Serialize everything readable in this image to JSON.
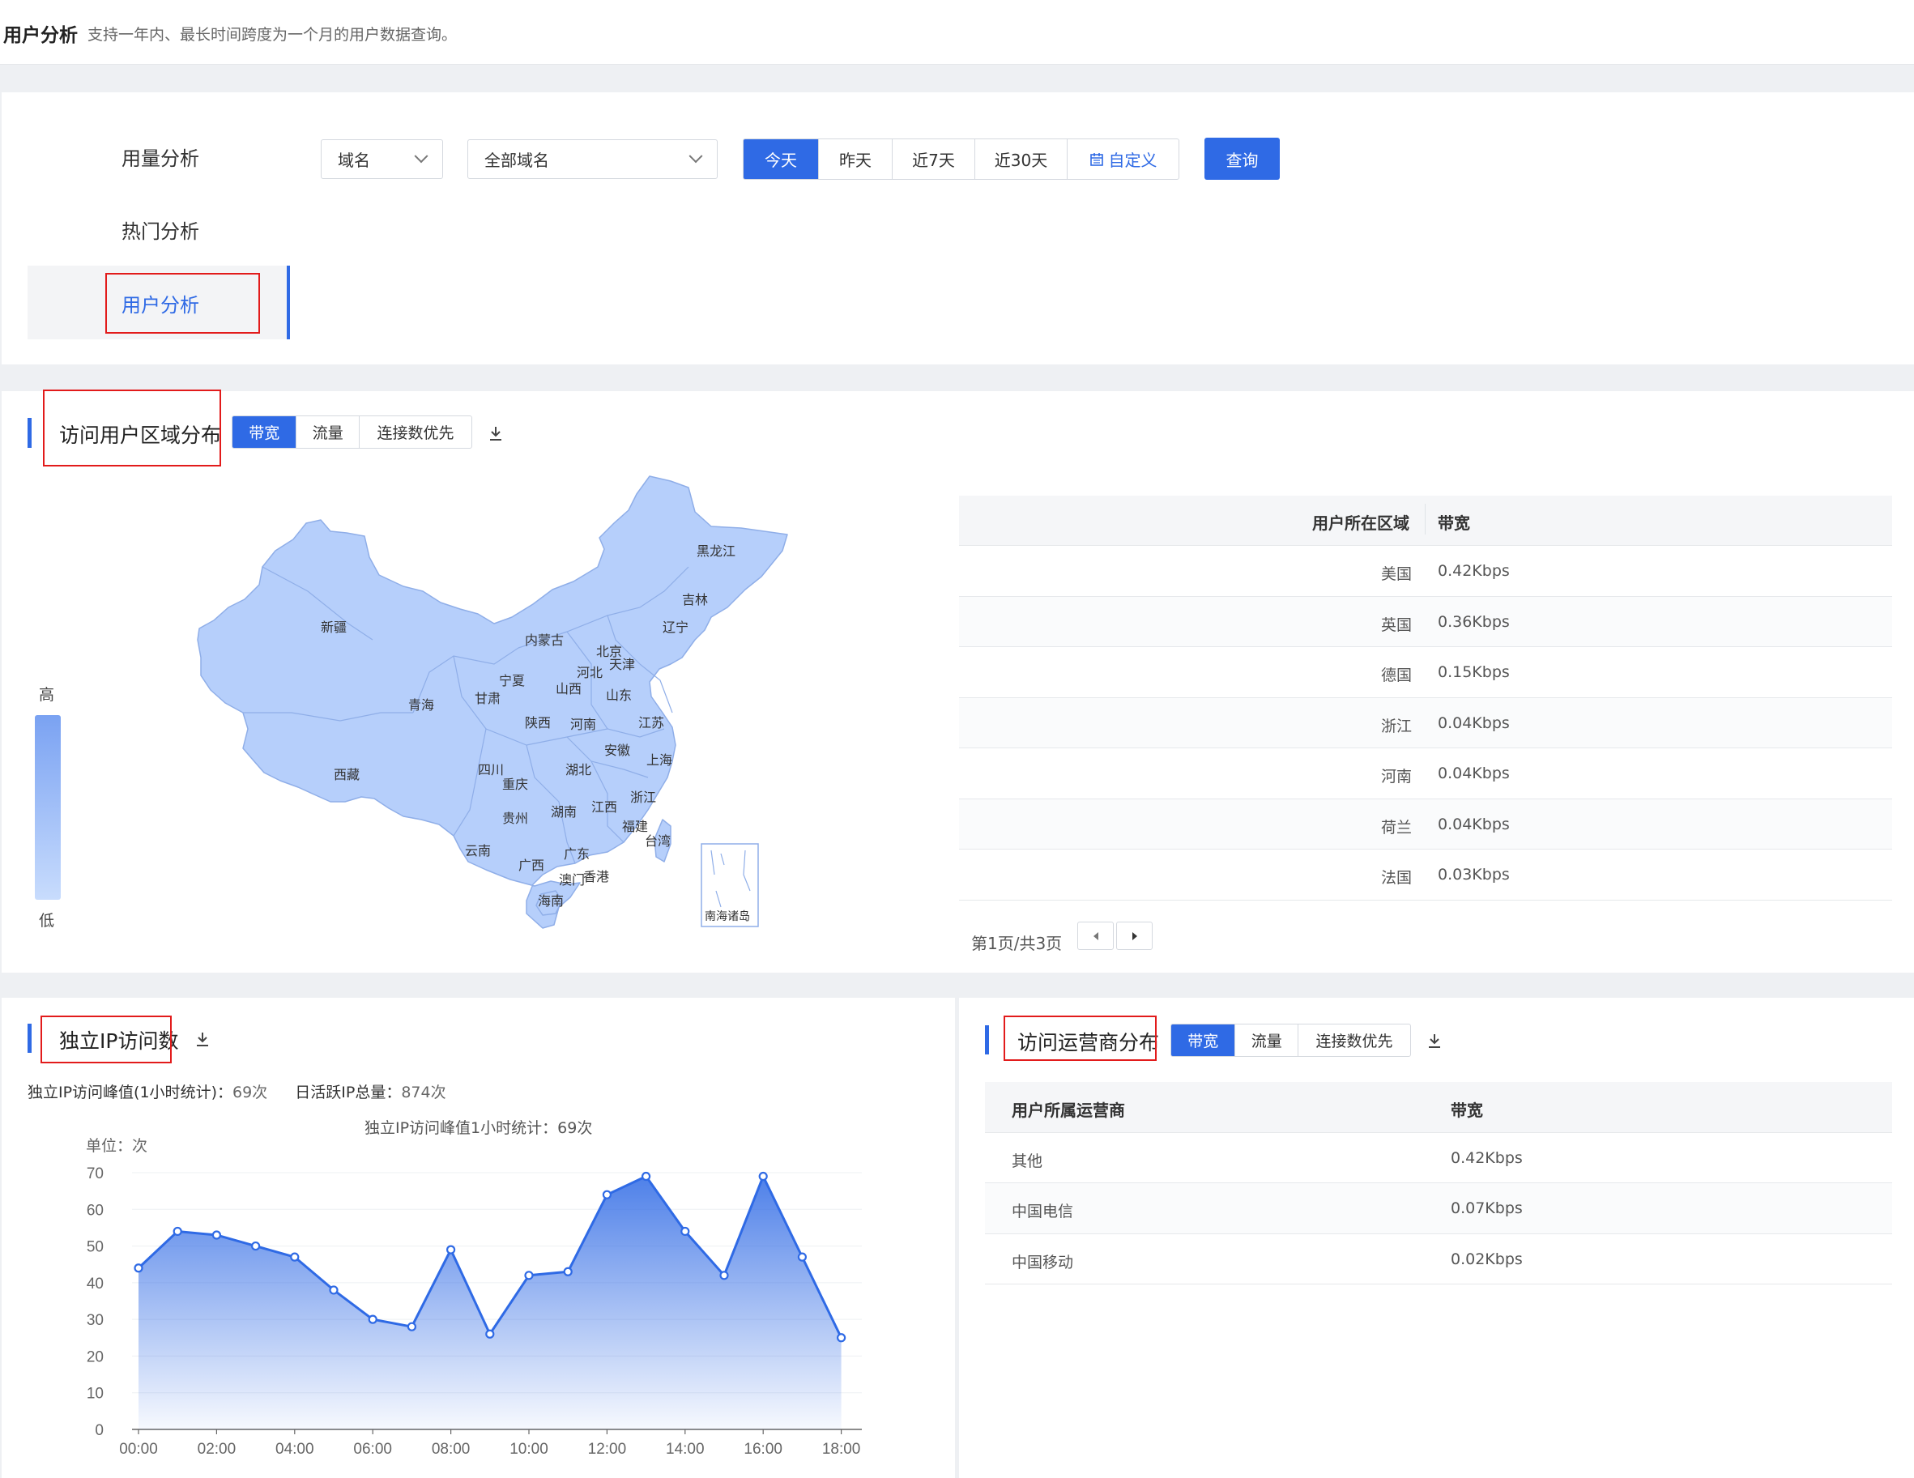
{
  "page": {
    "title": "用户分析",
    "subtitle": "支持一年内、最长时间跨度为一个月的用户数据查询。"
  },
  "nav": {
    "items": [
      {
        "label": "用量分析",
        "active": false
      },
      {
        "label": "热门分析",
        "active": false
      },
      {
        "label": "用户分析",
        "active": true
      }
    ]
  },
  "filters": {
    "type_select": "域名",
    "domain_select": "全部域名",
    "time_ranges": [
      "今天",
      "昨天",
      "近7天",
      "近30天"
    ],
    "time_active": "今天",
    "custom_label": "自定义",
    "query_button": "查询"
  },
  "region": {
    "title": "访问用户区域分布",
    "tabs": [
      "带宽",
      "流量",
      "连接数优先"
    ],
    "active_tab": "带宽",
    "legend_high": "高",
    "legend_low": "低",
    "map_colors": {
      "fill": "#b6cffb",
      "stroke": "#8faee8",
      "legend_top": "#7aa2f2",
      "legend_bottom": "#c8dcfd"
    },
    "provinces": [
      "黑龙江",
      "吉林",
      "辽宁",
      "内蒙古",
      "北京",
      "天津",
      "河北",
      "宁夏",
      "甘肃",
      "山西",
      "山东",
      "新疆",
      "青海",
      "陕西",
      "河南",
      "江苏",
      "安徽",
      "上海",
      "西藏",
      "四川",
      "重庆",
      "湖北",
      "浙江",
      "湖南",
      "江西",
      "贵州",
      "福建",
      "台湾",
      "云南",
      "广西",
      "广东",
      "澳门",
      "香港",
      "海南",
      "南海诸岛"
    ],
    "table": {
      "headers": [
        "用户所在区域",
        "带宽"
      ],
      "rows": [
        {
          "region": "美国",
          "value": "0.42Kbps"
        },
        {
          "region": "英国",
          "value": "0.36Kbps"
        },
        {
          "region": "德国",
          "value": "0.15Kbps"
        },
        {
          "region": "浙江",
          "value": "0.04Kbps"
        },
        {
          "region": "河南",
          "value": "0.04Kbps"
        },
        {
          "region": "荷兰",
          "value": "0.04Kbps"
        },
        {
          "region": "法国",
          "value": "0.03Kbps"
        }
      ],
      "pager": "第1页/共3页"
    }
  },
  "unique_ip": {
    "title": "独立IP访问数",
    "peak_label": "独立IP访问峰值(1小时统计)：",
    "peak_value": "69次",
    "total_label": "日活跃IP总量：",
    "total_value": "874次",
    "chart_caption": "独立IP访问峰值1小时统计：69次",
    "unit_label": "单位：次"
  },
  "isp": {
    "title": "访问运营商分布",
    "tabs": [
      "带宽",
      "流量",
      "连接数优先"
    ],
    "active_tab": "带宽",
    "headers": [
      "用户所属运营商",
      "带宽"
    ],
    "rows": [
      {
        "name": "其他",
        "value": "0.42Kbps"
      },
      {
        "name": "中国电信",
        "value": "0.07Kbps"
      },
      {
        "name": "中国移动",
        "value": "0.02Kbps"
      }
    ]
  },
  "chart_data": {
    "type": "area",
    "title": "独立IP访问峰值1小时统计：69次",
    "ylabel": "单位：次",
    "xlabel": "",
    "x_tick_labels": [
      "00:00",
      "02:00",
      "04:00",
      "06:00",
      "08:00",
      "10:00",
      "12:00",
      "14:00",
      "16:00",
      "18:00"
    ],
    "y_ticks": [
      0,
      10,
      20,
      30,
      40,
      50,
      60,
      70
    ],
    "ylim": [
      0,
      70
    ],
    "x": [
      "00:00",
      "01:00",
      "02:00",
      "03:00",
      "04:00",
      "05:00",
      "06:00",
      "07:00",
      "08:00",
      "09:00",
      "10:00",
      "11:00",
      "12:00",
      "13:00",
      "14:00",
      "15:00",
      "16:00",
      "17:00",
      "18:00"
    ],
    "series": [
      {
        "values": [
          44,
          54,
          53,
          50,
          47,
          38,
          30,
          28,
          49,
          26,
          42,
          43,
          64,
          69,
          54,
          42,
          69,
          47,
          25
        ],
        "color": "#2f6ae5"
      }
    ],
    "grid": true
  }
}
